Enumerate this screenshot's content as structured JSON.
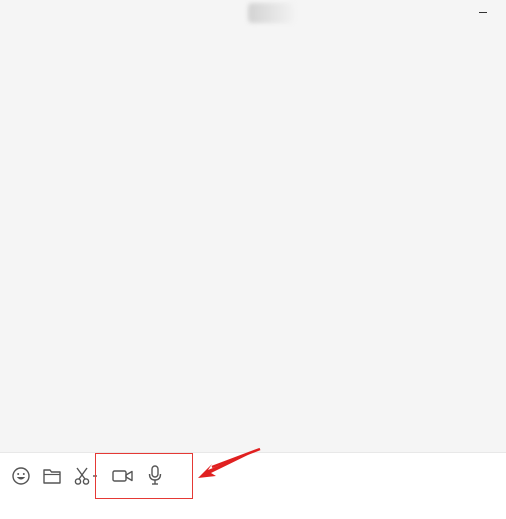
{
  "window": {
    "title_blurred": true,
    "minimize_icon": "minimize-icon"
  },
  "toolbar": {
    "icons": [
      "emoji-icon",
      "folder-icon",
      "screenshot-scissors-icon",
      "video-call-icon",
      "voice-call-icon"
    ]
  },
  "annotation": {
    "highlight_color": "#e53935",
    "arrow_color": "#e02020"
  }
}
